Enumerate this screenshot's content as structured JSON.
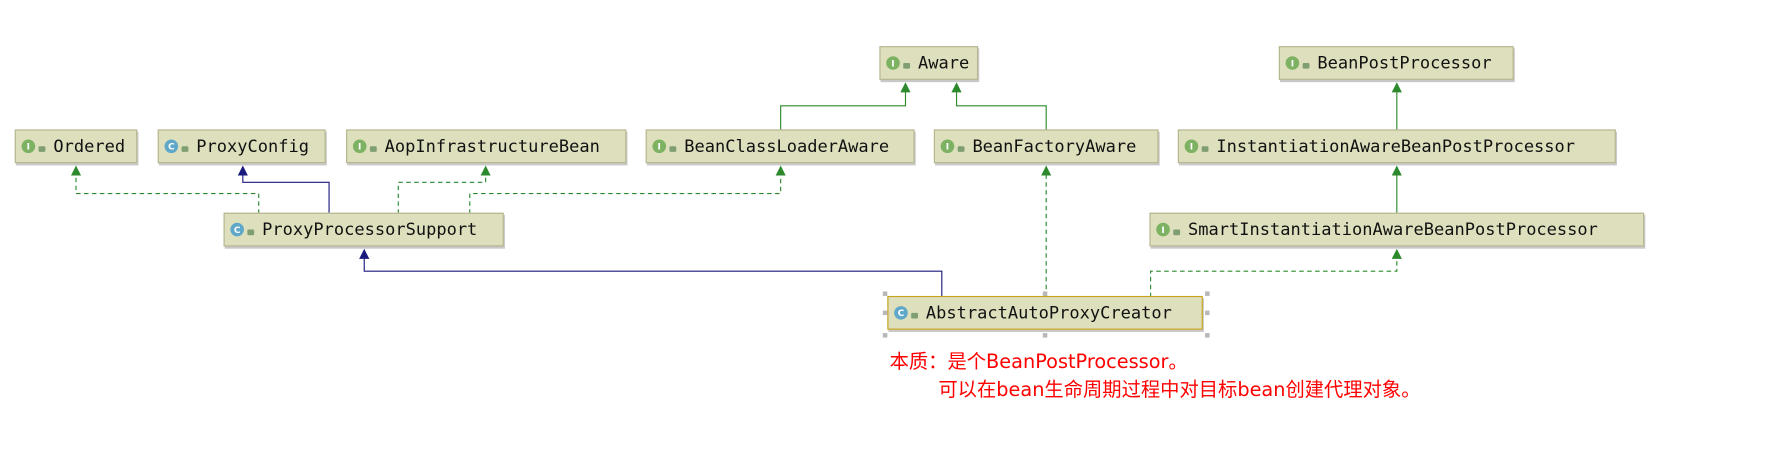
{
  "diagram": {
    "nodes": {
      "aware": {
        "label": "Aware",
        "kind": "interface"
      },
      "bean_post_processor": {
        "label": "BeanPostProcessor",
        "kind": "interface"
      },
      "ordered": {
        "label": "Ordered",
        "kind": "interface"
      },
      "proxy_config": {
        "label": "ProxyConfig",
        "kind": "class"
      },
      "aop_infrastructure_bean": {
        "label": "AopInfrastructureBean",
        "kind": "interface"
      },
      "bean_class_loader_aware": {
        "label": "BeanClassLoaderAware",
        "kind": "interface"
      },
      "bean_factory_aware": {
        "label": "BeanFactoryAware",
        "kind": "interface"
      },
      "instantiation_aware_bpp": {
        "label": "InstantiationAwareBeanPostProcessor",
        "kind": "interface"
      },
      "proxy_processor_support": {
        "label": "ProxyProcessorSupport",
        "kind": "class"
      },
      "smart_instantiation_aware_bpp": {
        "label": "SmartInstantiationAwareBeanPostProcessor",
        "kind": "interface"
      },
      "abstract_auto_proxy_creator": {
        "label": "AbstractAutoProxyCreator",
        "kind": "class",
        "selected": true
      }
    },
    "badge_letters": {
      "interface": "I",
      "class": "C"
    },
    "colors": {
      "implements": "#2c8a2c",
      "extends": "#1a1a7e",
      "note": "#ff0000",
      "node_fill": "#dedfbd"
    }
  },
  "note": {
    "line1": "本质：是个BeanPostProcessor。",
    "line2": "可以在bean生命周期过程中对目标bean创建代理对象。"
  }
}
